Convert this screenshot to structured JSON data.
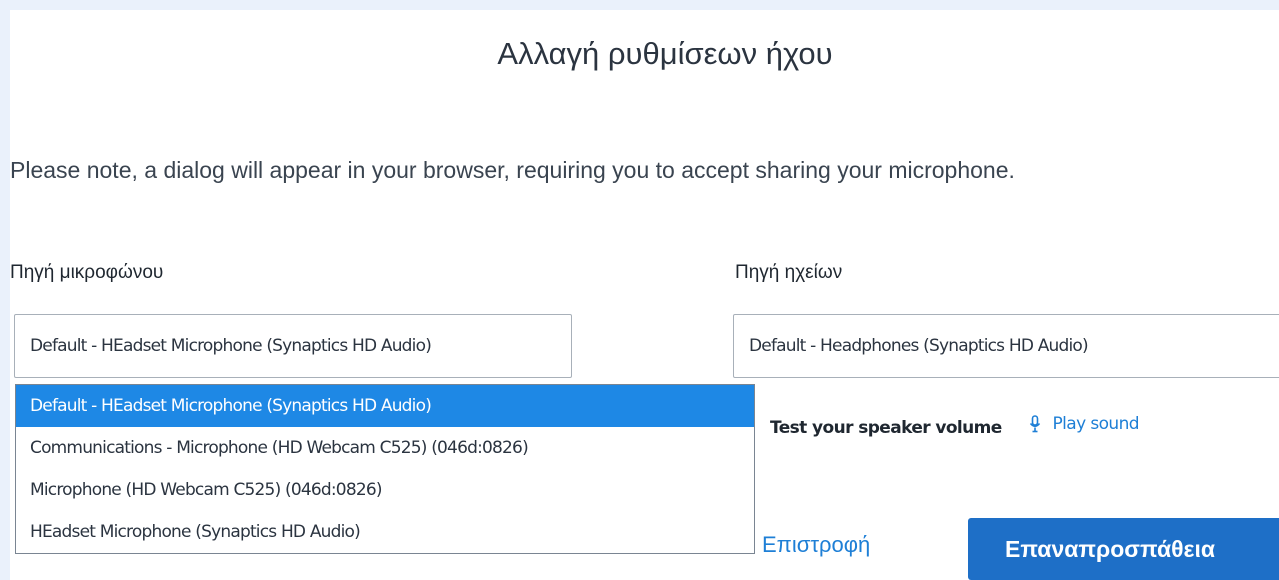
{
  "dialog": {
    "title": "Αλλαγή ρυθμίσεων ήχου",
    "note": "Please note, a dialog will appear in your browser, requiring you to accept sharing your microphone."
  },
  "microphone": {
    "label": "Πηγή μικροφώνου",
    "selected_value": "Default - HEadset Microphone (Synaptics HD Audio)",
    "options": [
      "Default - HEadset Microphone (Synaptics HD Audio)",
      "Communications - Microphone (HD Webcam C525) (046d:0826)",
      "Microphone (HD Webcam C525) (046d:0826)",
      "HEadset Microphone (Synaptics HD Audio)"
    ]
  },
  "speaker": {
    "label": "Πηγή ηχείων",
    "selected_value": "Default - Headphones (Synaptics HD Audio)",
    "test_label": "Test your speaker volume",
    "play_label": "Play sound",
    "play_icon": "microphone-icon"
  },
  "actions": {
    "back_label": "Επιστροφή",
    "retry_label": "Επαναπροσπάθεια"
  },
  "colors": {
    "accent": "#1e88e5",
    "primary_button": "#1e6fc7",
    "link": "#1e7fd6",
    "backdrop": "#eaf1fb"
  }
}
